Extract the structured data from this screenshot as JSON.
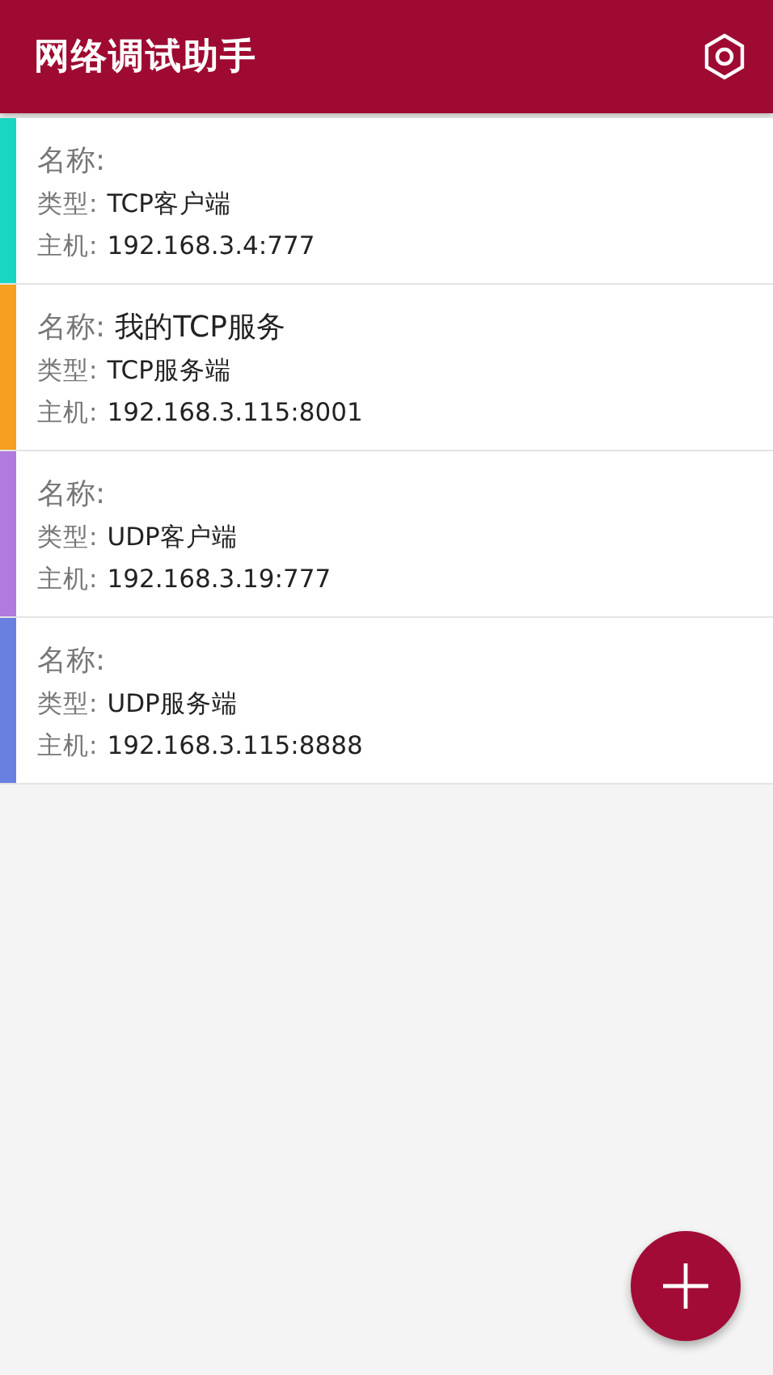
{
  "app_bar": {
    "title": "网络调试助手"
  },
  "connections": [
    {
      "color": "#19d6c2",
      "name": {
        "label": "名称:"
      },
      "type": {
        "label": "类型:",
        "value": "TCP客户端"
      },
      "host": {
        "label": "主机:",
        "value": "192.168.3.4:777"
      }
    },
    {
      "color": "#f5a01e",
      "name": {
        "label": "名称:",
        "value": "我的TCP服务"
      },
      "type": {
        "label": "类型:",
        "value": "TCP服务端"
      },
      "host": {
        "label": "主机:",
        "value": "192.168.3.115:8001"
      }
    },
    {
      "color": "#b07ade",
      "name": {
        "label": "名称:"
      },
      "type": {
        "label": "类型:",
        "value": "UDP客户端"
      },
      "host": {
        "label": "主机:",
        "value": "192.168.3.19:777"
      }
    },
    {
      "color": "#6a80e0",
      "name": {
        "label": "名称:"
      },
      "type": {
        "label": "类型:",
        "value": "UDP服务端"
      },
      "host": {
        "label": "主机:",
        "value": "192.168.3.115:8888"
      }
    }
  ]
}
